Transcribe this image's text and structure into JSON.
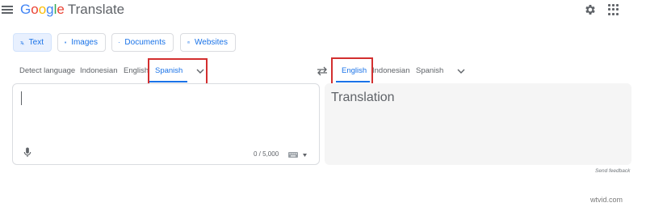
{
  "header": {
    "logo_word": [
      "G",
      "o",
      "o",
      "g",
      "l",
      "e"
    ],
    "product": "Translate"
  },
  "modes": [
    {
      "label": "Text",
      "active": true
    },
    {
      "label": "Images",
      "active": false
    },
    {
      "label": "Documents",
      "active": false
    },
    {
      "label": "Websites",
      "active": false
    }
  ],
  "source_languages": {
    "detect": "Detect language",
    "items": [
      "Indonesian",
      "English",
      "Spanish"
    ],
    "selected": "Spanish"
  },
  "target_languages": {
    "items": [
      "English",
      "Indonesian",
      "Spanish"
    ],
    "selected": "English"
  },
  "source": {
    "value": "",
    "char_count": "0 / 5,000"
  },
  "target": {
    "placeholder": "Translation"
  },
  "footer": {
    "feedback": "Send feedback"
  },
  "watermark": "wtvid.com",
  "colors": {
    "accent": "#1a73e8",
    "highlight": "#d32f2f",
    "target_bg": "#f5f5f5"
  },
  "icons": {
    "menu": "hamburger-menu-icon",
    "settings": "gear-icon",
    "apps": "apps-grid-icon",
    "text": "translate-text-icon",
    "images": "image-icon",
    "documents": "document-icon",
    "websites": "website-icon",
    "swap": "swap-languages-icon",
    "expand": "chevron-down-icon",
    "mic": "microphone-icon",
    "keyboard": "keyboard-icon"
  }
}
